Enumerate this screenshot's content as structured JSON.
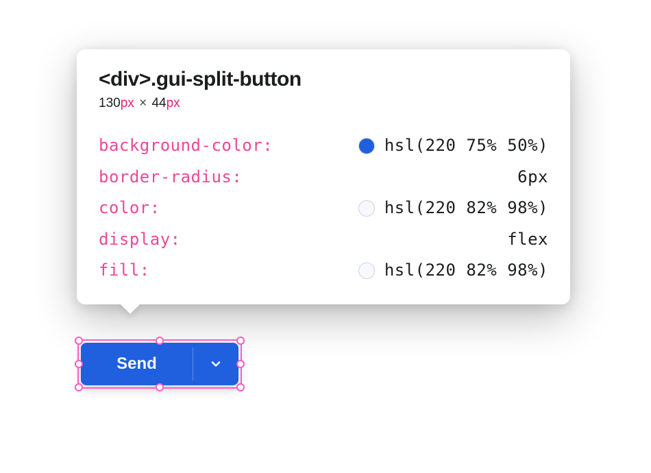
{
  "tooltip": {
    "element_tag": "<div>",
    "element_class": ".gui-split-button",
    "width_value": "130",
    "width_unit": "px",
    "times": "×",
    "height_value": "44",
    "height_unit": "px",
    "properties": [
      {
        "name": "background-color",
        "value": "hsl(220 75% 50%)",
        "swatch": "hsl(220,75%,50%)"
      },
      {
        "name": "border-radius",
        "value": "6px"
      },
      {
        "name": "color",
        "value": "hsl(220 82% 98%)",
        "swatch": "hsl(220,82%,98%)"
      },
      {
        "name": "display",
        "value": "flex"
      },
      {
        "name": "fill",
        "value": "hsl(220 82% 98%)",
        "swatch": "hsl(220,82%,98%)"
      }
    ]
  },
  "button": {
    "label": "Send"
  }
}
